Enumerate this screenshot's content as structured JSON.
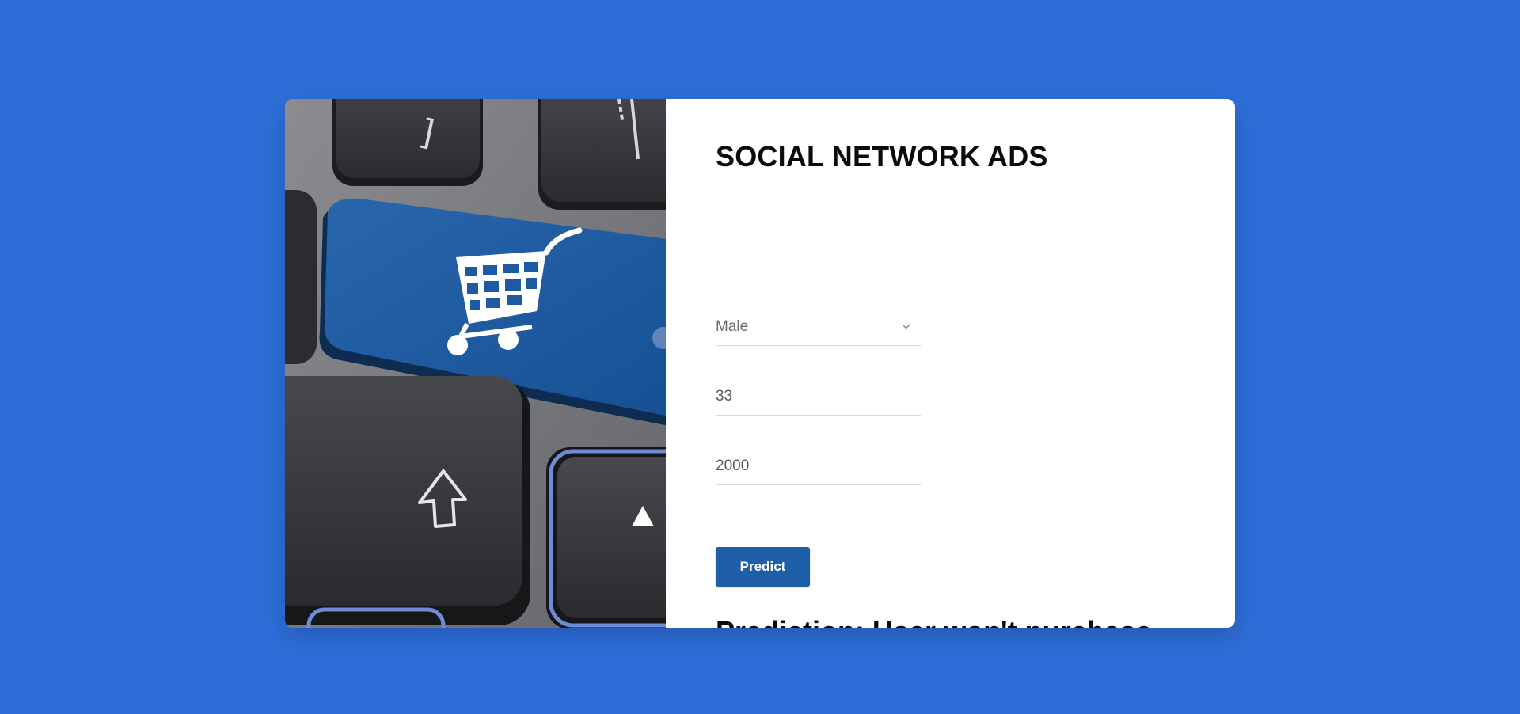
{
  "header": {
    "title": "SOCIAL NETWORK ADS"
  },
  "form": {
    "gender": {
      "selected": "Male",
      "icon": "chevron-down-icon"
    },
    "age": {
      "value": "33"
    },
    "salary": {
      "value": "2000"
    },
    "predict_label": "Predict"
  },
  "result": {
    "text": "Prediction: User won't purchase product"
  },
  "hero_image": {
    "icon": "shopping-cart-icon"
  },
  "colors": {
    "background": "#2e6ed8",
    "button": "#1f5ea8",
    "card": "#ffffff",
    "text": "#0b0b0b"
  }
}
